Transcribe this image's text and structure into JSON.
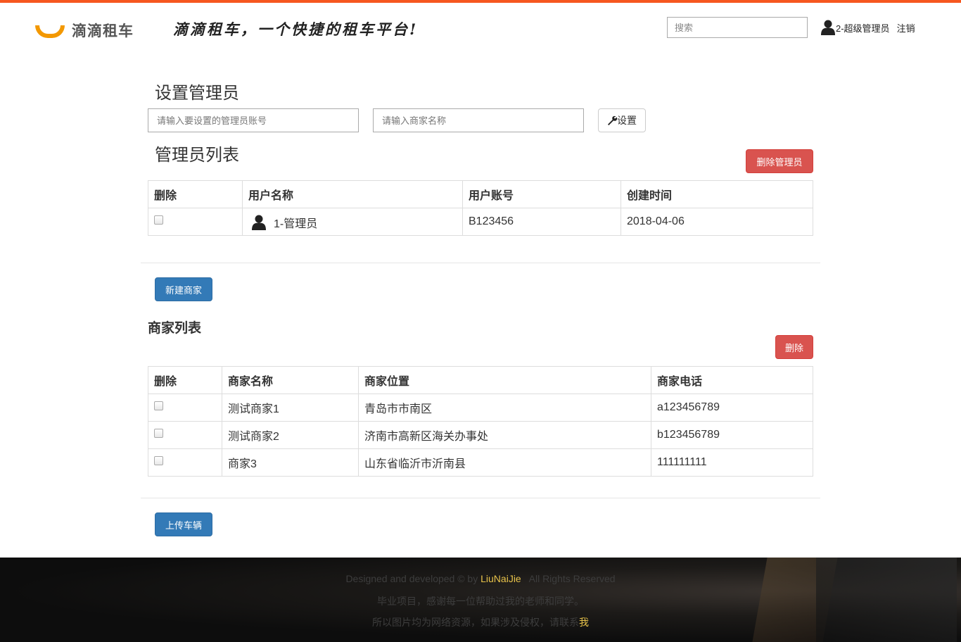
{
  "header": {
    "logo_text": "滴滴租车",
    "slogan": "滴滴租车，一个快捷的租车平台!",
    "search_placeholder": "搜索",
    "user_name": "2-超级管理员",
    "logout_label": "注销",
    "brand_color": "#f39800",
    "accent_color": "#f6571f"
  },
  "set_admin": {
    "title": "设置管理员",
    "account_placeholder": "请输入要设置的管理员账号",
    "merchant_placeholder": "请输入商家名称",
    "set_button": "设置"
  },
  "admin_list": {
    "title": "管理员列表",
    "delete_button": "删除管理员",
    "columns": [
      "删除",
      "用户名称",
      "用户账号",
      "创建时间"
    ],
    "rows": [
      {
        "name": "1-管理员",
        "account": "B123456",
        "created": "2018-04-06"
      }
    ]
  },
  "new_merchant_button": "新建商家",
  "merchant_list": {
    "title": "商家列表",
    "delete_button": "删除",
    "columns": [
      "删除",
      "商家名称",
      "商家位置",
      "商家电话"
    ],
    "rows": [
      {
        "name": "测试商家1",
        "location": "青岛市市南区",
        "phone": "a123456789"
      },
      {
        "name": "测试商家2",
        "location": "济南市高新区海关办事处",
        "phone": "b123456789"
      },
      {
        "name": "商家3",
        "location": "山东省临沂市沂南县",
        "phone": "111111111"
      }
    ]
  },
  "upload_vehicle_button": "上传车辆",
  "footer": {
    "line1_prefix": "Designed and developed © by",
    "line1_author": "LiuNaiJie",
    "line1_suffix": "All Rights Reserved",
    "line2": "毕业项目，感谢每一位帮助过我的老师和同学。",
    "line3_prefix": "所以图片均为网络资源，如果涉及侵权，请联系",
    "line3_link": "我"
  },
  "icons": {
    "user": "user-silhouette-icon",
    "wrench": "wrench-icon"
  }
}
